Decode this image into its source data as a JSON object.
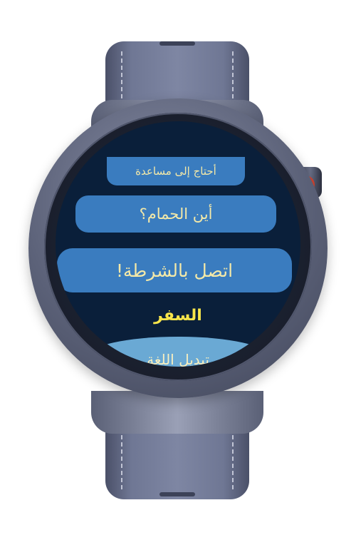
{
  "screen": {
    "title": "السفر",
    "buttons": {
      "help": "أحتاج إلى مساعدة",
      "toilet": "أين الحمام؟",
      "police": "اتصل بالشرطة!",
      "change_language": "تبديل اللغة"
    }
  },
  "colors": {
    "screen_background": "#0a1f3a",
    "button_background": "#3a7cbf",
    "button_text": "#f4e9a8",
    "title_text": "#f7e54a",
    "language_button_background": "#6aa9d4"
  }
}
